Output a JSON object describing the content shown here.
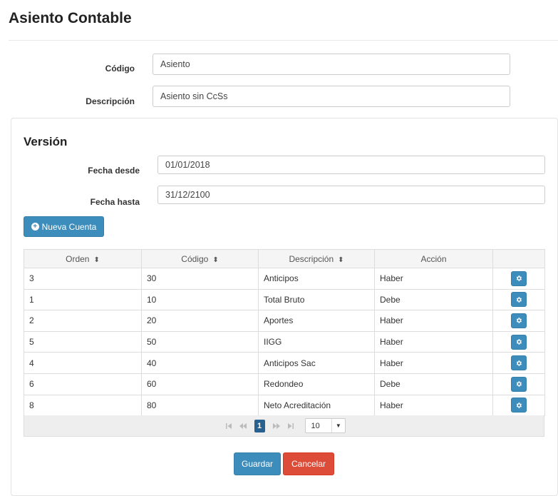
{
  "page": {
    "title": "Asiento Contable"
  },
  "form": {
    "codigo": {
      "label": "Código",
      "value": "Asiento"
    },
    "descripcion": {
      "label": "Descripción",
      "value": "Asiento sin CcSs"
    }
  },
  "version": {
    "title": "Versión",
    "fecha_desde": {
      "label": "Fecha desde",
      "value": "01/01/2018"
    },
    "fecha_hasta": {
      "label": "Fecha hasta",
      "value": "31/12/2100"
    },
    "new_account_label": "Nueva Cuenta"
  },
  "table": {
    "columns": [
      "Orden",
      "Código",
      "Descripción",
      "Acción"
    ],
    "sort_icon": "⬍",
    "rows": [
      {
        "orden": "3",
        "codigo": "30",
        "descripcion": "Anticipos",
        "accion": "Haber"
      },
      {
        "orden": "1",
        "codigo": "10",
        "descripcion": "Total Bruto",
        "accion": "Debe"
      },
      {
        "orden": "2",
        "codigo": "20",
        "descripcion": "Aportes",
        "accion": "Haber"
      },
      {
        "orden": "5",
        "codigo": "50",
        "descripcion": "IIGG",
        "accion": "Haber"
      },
      {
        "orden": "4",
        "codigo": "40",
        "descripcion": "Anticipos Sac",
        "accion": "Haber"
      },
      {
        "orden": "6",
        "codigo": "60",
        "descripcion": "Redondeo",
        "accion": "Debe"
      },
      {
        "orden": "8",
        "codigo": "80",
        "descripcion": "Neto Acreditación",
        "accion": "Haber"
      }
    ]
  },
  "pager": {
    "current_page": "1",
    "page_size": "10"
  },
  "footer": {
    "save_label": "Guardar",
    "cancel_label": "Cancelar"
  },
  "colors": {
    "primary": "#3c8dbc",
    "danger": "#dd4b39",
    "pager_active": "#286090"
  }
}
